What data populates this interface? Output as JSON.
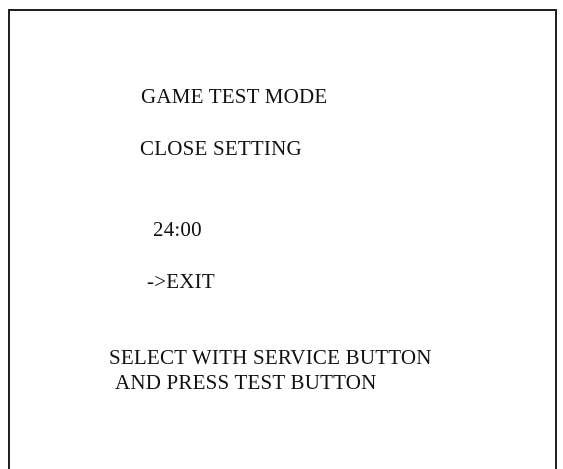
{
  "screen": {
    "title": "GAME TEST MODE",
    "menu_title": "CLOSE SETTING",
    "close_time": "24:00",
    "cursor_option": "->EXIT",
    "instruction_line1": "SELECT WITH SERVICE BUTTON",
    "instruction_line2": "AND PRESS TEST BUTTON"
  }
}
